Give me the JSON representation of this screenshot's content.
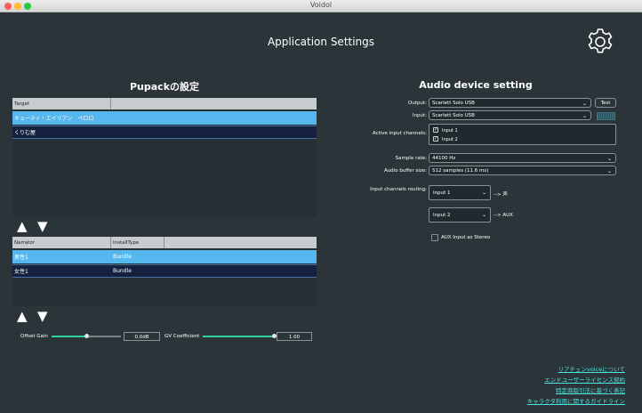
{
  "window": {
    "title": "Voidol",
    "traffic_lights": {
      "close": "#ff5f56",
      "minimize": "#ffbd2e",
      "maximize": "#27c93f"
    }
  },
  "header": {
    "title": "Application Settings",
    "settings_icon": "gear-icon"
  },
  "pupack": {
    "title": "Pupackの設定",
    "target_table": {
      "columns": [
        "Target",
        ""
      ],
      "rows": [
        {
          "name": "キューティ・エイリアン　ペロロ",
          "selected": true
        },
        {
          "name": "くりむ屋",
          "selected": false
        }
      ]
    },
    "target_arrows": {
      "up": "▲",
      "down": "▼"
    },
    "narrator_table": {
      "columns": [
        "Narrator",
        "InstallType",
        ""
      ],
      "rows": [
        {
          "name": "男性1",
          "install_type": "Bundle",
          "selected": true
        },
        {
          "name": "女性1",
          "install_type": "Bundle",
          "selected": false
        }
      ]
    },
    "narrator_arrows": {
      "up": "▲",
      "down": "▼"
    },
    "offset_gain": {
      "label": "Offset Gain",
      "value": "0.0dB",
      "position": 0.5
    },
    "gv_coefficient": {
      "label": "GV Coefficient",
      "value": "1.00",
      "position": 1.0
    }
  },
  "audio": {
    "title": "Audio device setting",
    "output": {
      "label": "Output:",
      "value": "Scarlett Solo USB",
      "test_label": "Test"
    },
    "input": {
      "label": "Input:",
      "value": "Scarlett Solo USB"
    },
    "active_channels": {
      "label": "Active input channels:",
      "channels": [
        {
          "name": "Input 1",
          "checked": true
        },
        {
          "name": "Input 2",
          "checked": true
        }
      ]
    },
    "sample_rate": {
      "label": "Sample rate:",
      "value": "44100 Hz"
    },
    "buffer_size": {
      "label": "Audio buffer size:",
      "value": "512 samples (11.6 ms)"
    },
    "routing": {
      "label": "Input channels routing:",
      "routes": [
        {
          "source": "Input 1",
          "dest": "--> 声"
        },
        {
          "source": "Input 2",
          "dest": "--> AUX"
        }
      ]
    },
    "aux_stereo": {
      "label": "AUX Input as Stereo",
      "checked": false
    }
  },
  "links": [
    "リアチェンvoiceについて",
    "エンドユーザーライセンス契約",
    "特定商取引法に基づく表記",
    "キャラクタ利用に関するガイドライン"
  ],
  "colors": {
    "accent": "#56b7ef",
    "slider": "#2fd39b",
    "link": "#4fe0df",
    "background": "#2b3438"
  }
}
